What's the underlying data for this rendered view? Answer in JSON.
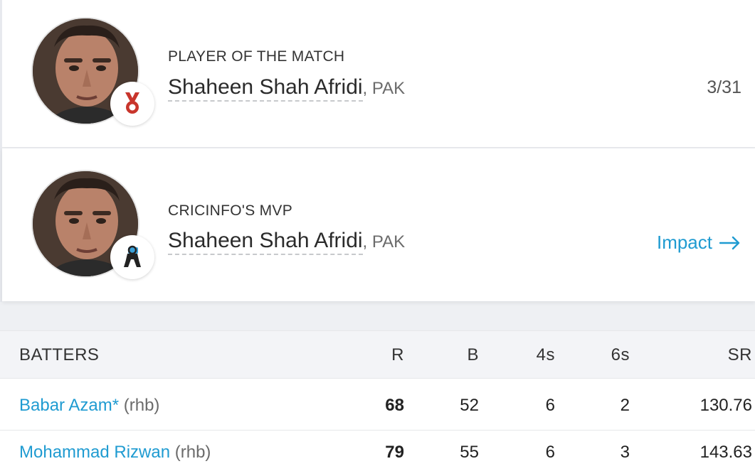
{
  "potm": {
    "label": "PLAYER OF THE MATCH",
    "player": "Shaheen Shah Afridi",
    "team": ", PAK",
    "figure": "3/31",
    "badge_icon": "medal-icon"
  },
  "mvp": {
    "label": "CRICINFO'S MVP",
    "player": "Shaheen Shah Afridi",
    "team": ", PAK",
    "link": "Impact",
    "link_icon": "arrow-right-icon",
    "badge_icon": "mvp-icon"
  },
  "batting": {
    "headers": [
      "BATTERS",
      "R",
      "B",
      "4s",
      "6s",
      "SR"
    ],
    "rows": [
      {
        "name": "Babar Azam*",
        "hand": " (rhb)",
        "r": "68",
        "b": "52",
        "fours": "6",
        "sixes": "2",
        "sr": "130.76"
      },
      {
        "name": "Mohammad Rizwan",
        "hand": " (rhb)",
        "r": "79",
        "b": "55",
        "fours": "6",
        "sixes": "3",
        "sr": "143.63"
      }
    ]
  },
  "colors": {
    "link": "#1f9bd1",
    "header_bg": "#f3f4f7",
    "medal": "#c8352c"
  }
}
